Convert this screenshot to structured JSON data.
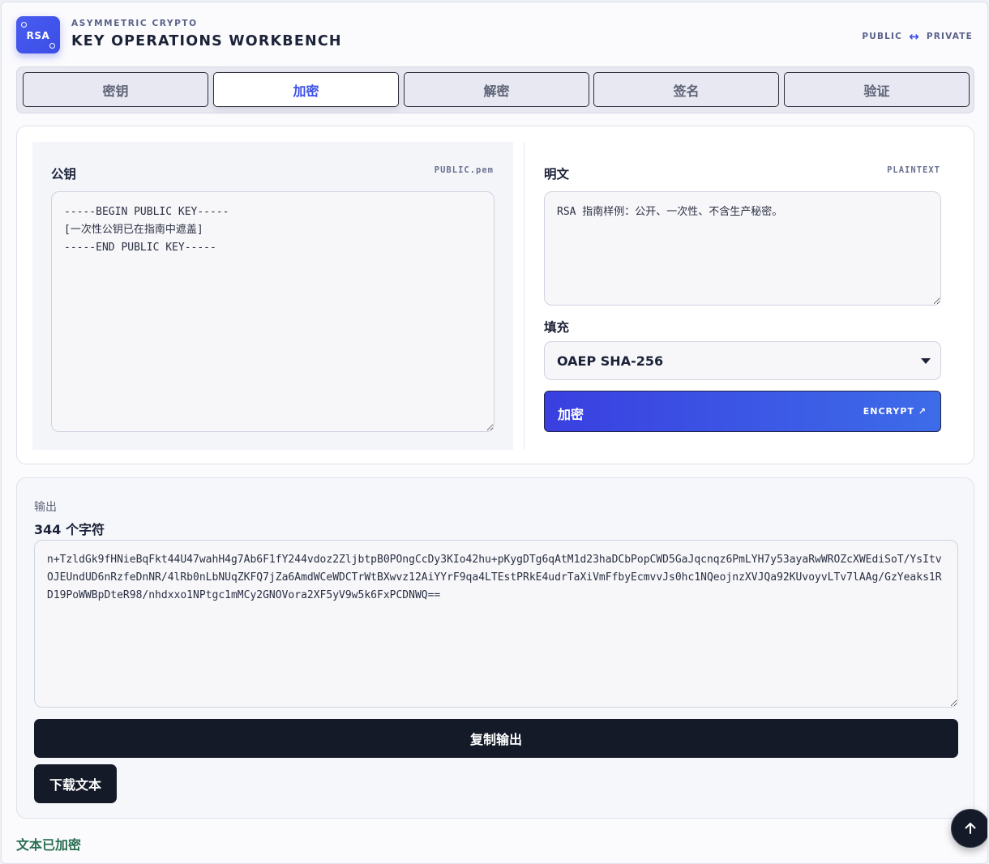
{
  "header": {
    "logo_text": "RSA",
    "eyebrow": "ASYMMETRIC CRYPTO",
    "title": "KEY OPERATIONS WORKBENCH",
    "flow_left": "PUBLIC",
    "flow_arrow": "↔",
    "flow_right": "PRIVATE"
  },
  "tabs": [
    {
      "label": "密钥",
      "active": false
    },
    {
      "label": "加密",
      "active": true
    },
    {
      "label": "解密",
      "active": false
    },
    {
      "label": "签名",
      "active": false
    },
    {
      "label": "验证",
      "active": false
    }
  ],
  "encrypt": {
    "public_key_label": "公钥",
    "public_key_tag": "PUBLIC.pem",
    "public_key_value": "-----BEGIN PUBLIC KEY-----\n[一次性公钥已在指南中遮盖]\n-----END PUBLIC KEY-----",
    "plaintext_label": "明文",
    "plaintext_tag": "PLAINTEXT",
    "plaintext_value": "RSA 指南样例：公开、一次性、不含生产秘密。",
    "padding_label": "填充",
    "padding_selected": "OAEP SHA-256",
    "button_label": "加密",
    "button_hint": "ENCRYPT ↗"
  },
  "output": {
    "label": "输出",
    "count": "344 个字符",
    "value": "n+TzldGk9fHNieBqFkt44U47wahH4g7Ab6F1fY244vdoz2ZljbtpB0POngCcDy3KIo42hu+pKygDTg6qAtM1d23haDCbPopCWD5GaJqcnqz6PmLYH7y53ayaRwWROZcXWEdiSoT/YsItvOJEUndUD6nRzfeDnNR/4lRb0nLbNUqZKFQ7jZa6AmdWCeWDCTrWtBXwvz12AiYYrF9qa4LTEstPRkE4udrTaXiVmFfbyEcmvvJs0hc1NQeojnzXVJQa92KUvoyvLTv7lAAg/GzYeaks1RD19PoWWBpDteR98/nhdxxo1NPtgc1mMCy2GNOVora2XF5yV9w5k6FxPCDNWQ==",
    "copy_label": "复制输出",
    "download_label": "下载文本"
  },
  "status": "文本已加密",
  "fab_icon": "arrow-up-icon",
  "colors": {
    "accent": "#3d4fe8",
    "dark_button": "#141a28",
    "status_green": "#2a6e52"
  }
}
